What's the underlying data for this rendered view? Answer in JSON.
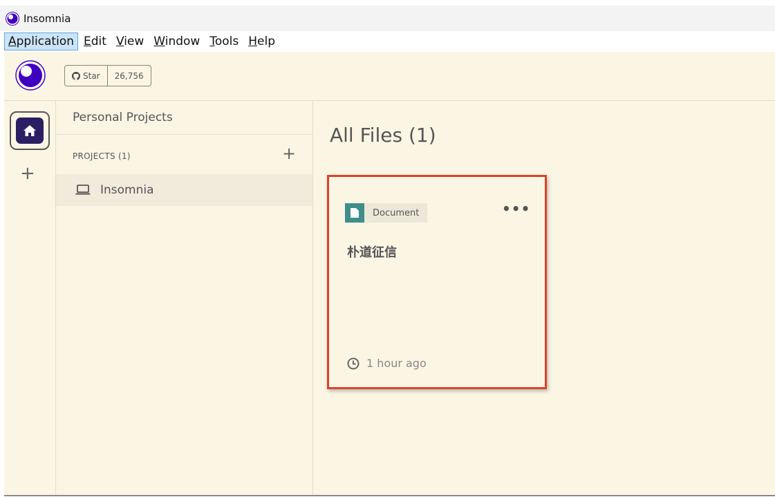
{
  "window": {
    "title": "Insomnia",
    "accent": "#4000bf"
  },
  "menu": {
    "items": [
      {
        "key": "application",
        "first": "A",
        "rest": "pplication",
        "active": true
      },
      {
        "key": "edit",
        "first": "E",
        "rest": "dit"
      },
      {
        "key": "view",
        "first": "V",
        "rest": "iew"
      },
      {
        "key": "window",
        "first": "W",
        "rest": "indow"
      },
      {
        "key": "tools",
        "first": "T",
        "rest": "ools"
      },
      {
        "key": "help",
        "first": "H",
        "rest": "elp"
      }
    ]
  },
  "topbar": {
    "star_label": "Star",
    "star_count": "26,756",
    "icons": [
      "insomnia-logo-icon",
      "github-icon"
    ]
  },
  "sidebar": {
    "org_name": "Personal Projects",
    "projects_header": "PROJECTS (1)",
    "add_label": "+",
    "projects": [
      {
        "name": "Insomnia",
        "icon": "laptop-icon"
      }
    ]
  },
  "rail": {
    "add_label": "+",
    "home_icon": "home-icon"
  },
  "main": {
    "title": "All Files (1)",
    "cards": [
      {
        "type_label": "Document",
        "more_label": "•••",
        "title": "朴道征信",
        "modified": "1 hour ago",
        "type_color": "#3f8e8c",
        "highlight_color": "#d9432a"
      }
    ]
  }
}
